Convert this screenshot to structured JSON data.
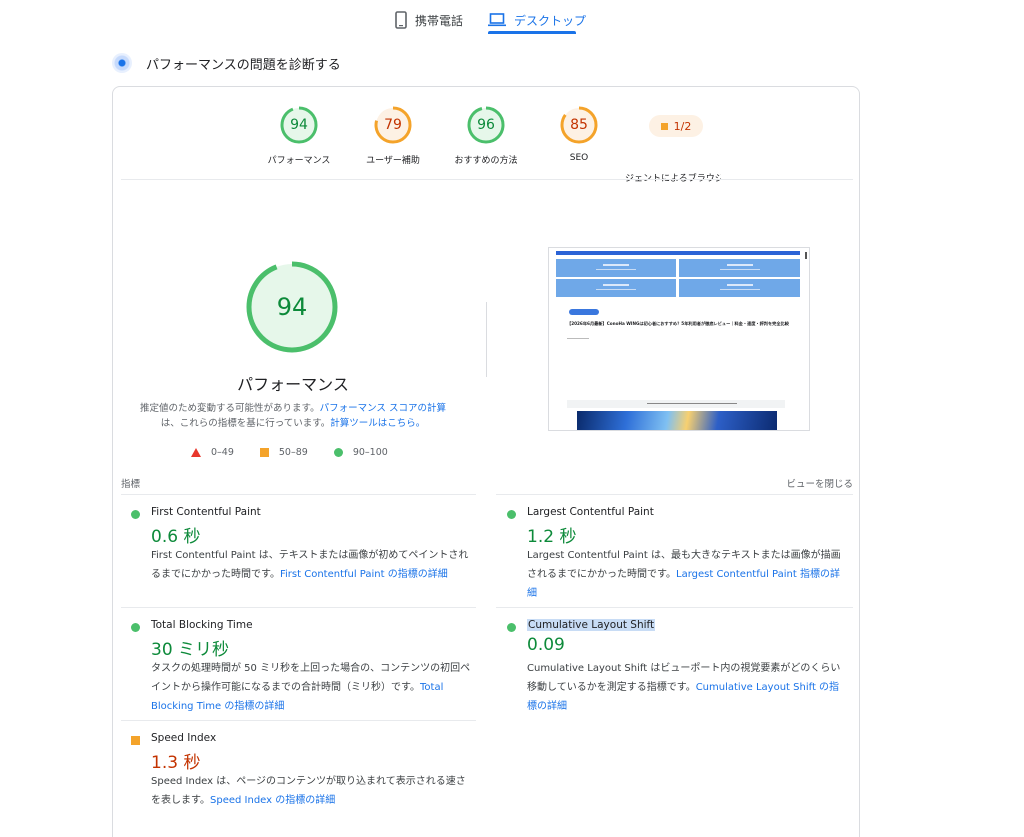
{
  "tabs": {
    "mobile": "携帯電話",
    "desktop": "デスクトップ"
  },
  "section": {
    "title": "パフォーマンスの問題を診断する"
  },
  "gauges": [
    {
      "score": "94",
      "label": "パフォーマンス",
      "score_fraction": 0.94,
      "color": "#0cce6b"
    },
    {
      "score": "79",
      "label": "ユーザー補助",
      "score_fraction": 0.79,
      "color": "#ffa400"
    },
    {
      "score": "96",
      "label": "おすすめの方法",
      "score_fraction": 0.96,
      "color": "#0cce6b"
    },
    {
      "score": "85",
      "label": "SEO",
      "score_fraction": 0.85,
      "color": "#ffa400"
    }
  ],
  "pwa": {
    "value": "1/2",
    "label": "ジェントによるブラウジ"
  },
  "performance": {
    "score": "94",
    "score_fraction": 0.94,
    "title": "パフォーマンス",
    "desc_part1": "推定値のため変動する可能性があります。",
    "desc_link1": "パフォーマンス スコアの計算",
    "desc_part2": "は、これらの指標を基に行っています。",
    "desc_link2": "計算ツールはこちら。"
  },
  "legend": {
    "poor": "0–49",
    "average": "50–89",
    "good": "90–100"
  },
  "screenshot": {
    "headline": "【2026年6月最新】ConoHa WINGは初心者におすすめ？5年利用者が徹底レビュー｜料金・速度・評判を完全比較"
  },
  "metrics_header": {
    "left": "指標",
    "right": "ビューを閉じる"
  },
  "metrics": {
    "fcp": {
      "name": "First Contentful Paint",
      "value": "0.6 秒",
      "desc": "First Contentful Paint は、テキストまたは画像が初めてペイントされるまでにかかった時間です。",
      "link": "First Contentful Paint の指標の詳細"
    },
    "lcp": {
      "name": "Largest Contentful Paint",
      "value": "1.2 秒",
      "desc": "Largest Contentful Paint は、最も大きなテキストまたは画像が描画されるまでにかかった時間です。",
      "link": "Largest Contentful Paint 指標の詳細"
    },
    "tbt": {
      "name": "Total Blocking Time",
      "value": "30 ミリ秒",
      "desc": "タスクの処理時間が 50 ミリ秒を上回った場合の、コンテンツの初回ペイントから操作可能になるまでの合計時間（ミリ秒）です。",
      "link": "Total Blocking Time の指標の詳細"
    },
    "cls": {
      "name": "Cumulative Layout Shift",
      "value": "0.09",
      "desc": "Cumulative Layout Shift はビューポート内の視覚要素がどのくらい移動しているかを測定する指標です。",
      "link": "Cumulative Layout Shift の指標の詳細"
    },
    "si": {
      "name": "Speed Index",
      "value": "1.3 秒",
      "desc": "Speed Index は、ページのコンテンツが取り込まれて表示される速さを表します。",
      "link": "Speed Index の指標の詳細"
    }
  },
  "colors": {
    "good": "#0cce6b",
    "average": "#ffa400",
    "poor": "#ff4e42",
    "link": "#1a73e8"
  }
}
